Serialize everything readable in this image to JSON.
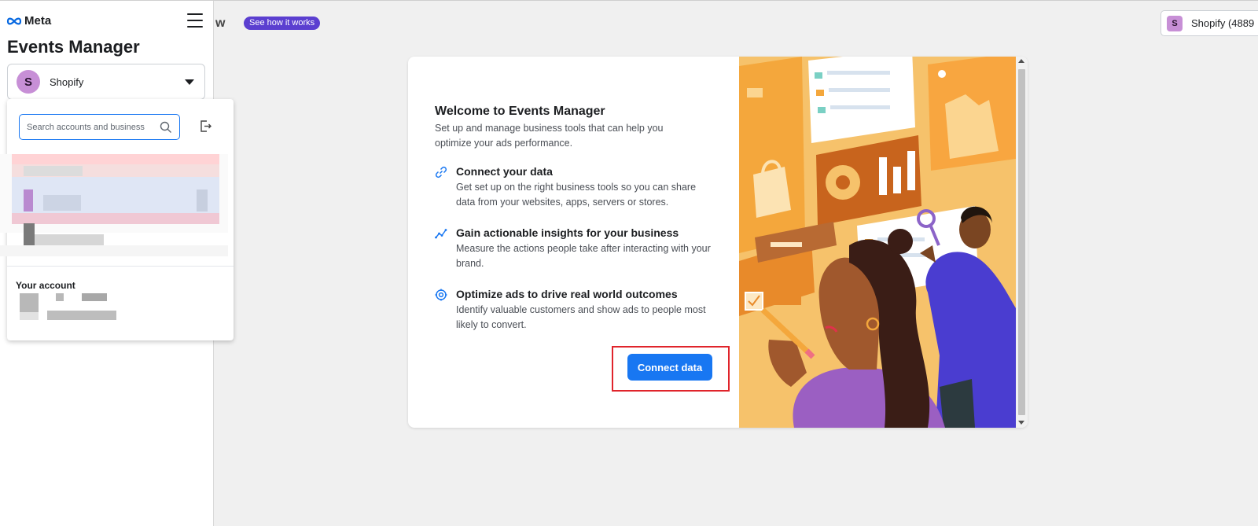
{
  "sidebar": {
    "brand": "Meta",
    "app_title": "Events Manager",
    "selected_account": {
      "initial": "S",
      "name": "Shopify"
    }
  },
  "dropdown": {
    "search_placeholder": "Search accounts and business",
    "section_your_account": "Your account"
  },
  "header": {
    "partial_title": "w",
    "see_how_label": "See how it works",
    "account_chip": {
      "initial": "S",
      "label": "Shopify (4889"
    }
  },
  "welcome_modal": {
    "title": "Welcome to Events Manager",
    "subtitle": "Set up and manage business tools that can help you optimize your ads performance.",
    "features": [
      {
        "icon": "link-icon",
        "title": "Connect your data",
        "description": "Get set up on the right business tools so you can share data from your websites, apps, servers or stores."
      },
      {
        "icon": "insights-icon",
        "title": "Gain actionable insights for your business",
        "description": "Measure the actions people take after interacting with your brand."
      },
      {
        "icon": "target-icon",
        "title": "Optimize ads to drive real world outcomes",
        "description": "Identify valuable customers and show ads to people most likely to convert."
      }
    ],
    "cta_label": "Connect data"
  },
  "colors": {
    "accent_blue": "#1877f2",
    "badge_purple": "#5b3fd0",
    "avatar_purple": "#c78fd6",
    "highlight_red": "#e0242b",
    "illustration_orange": "#f6c26b"
  }
}
